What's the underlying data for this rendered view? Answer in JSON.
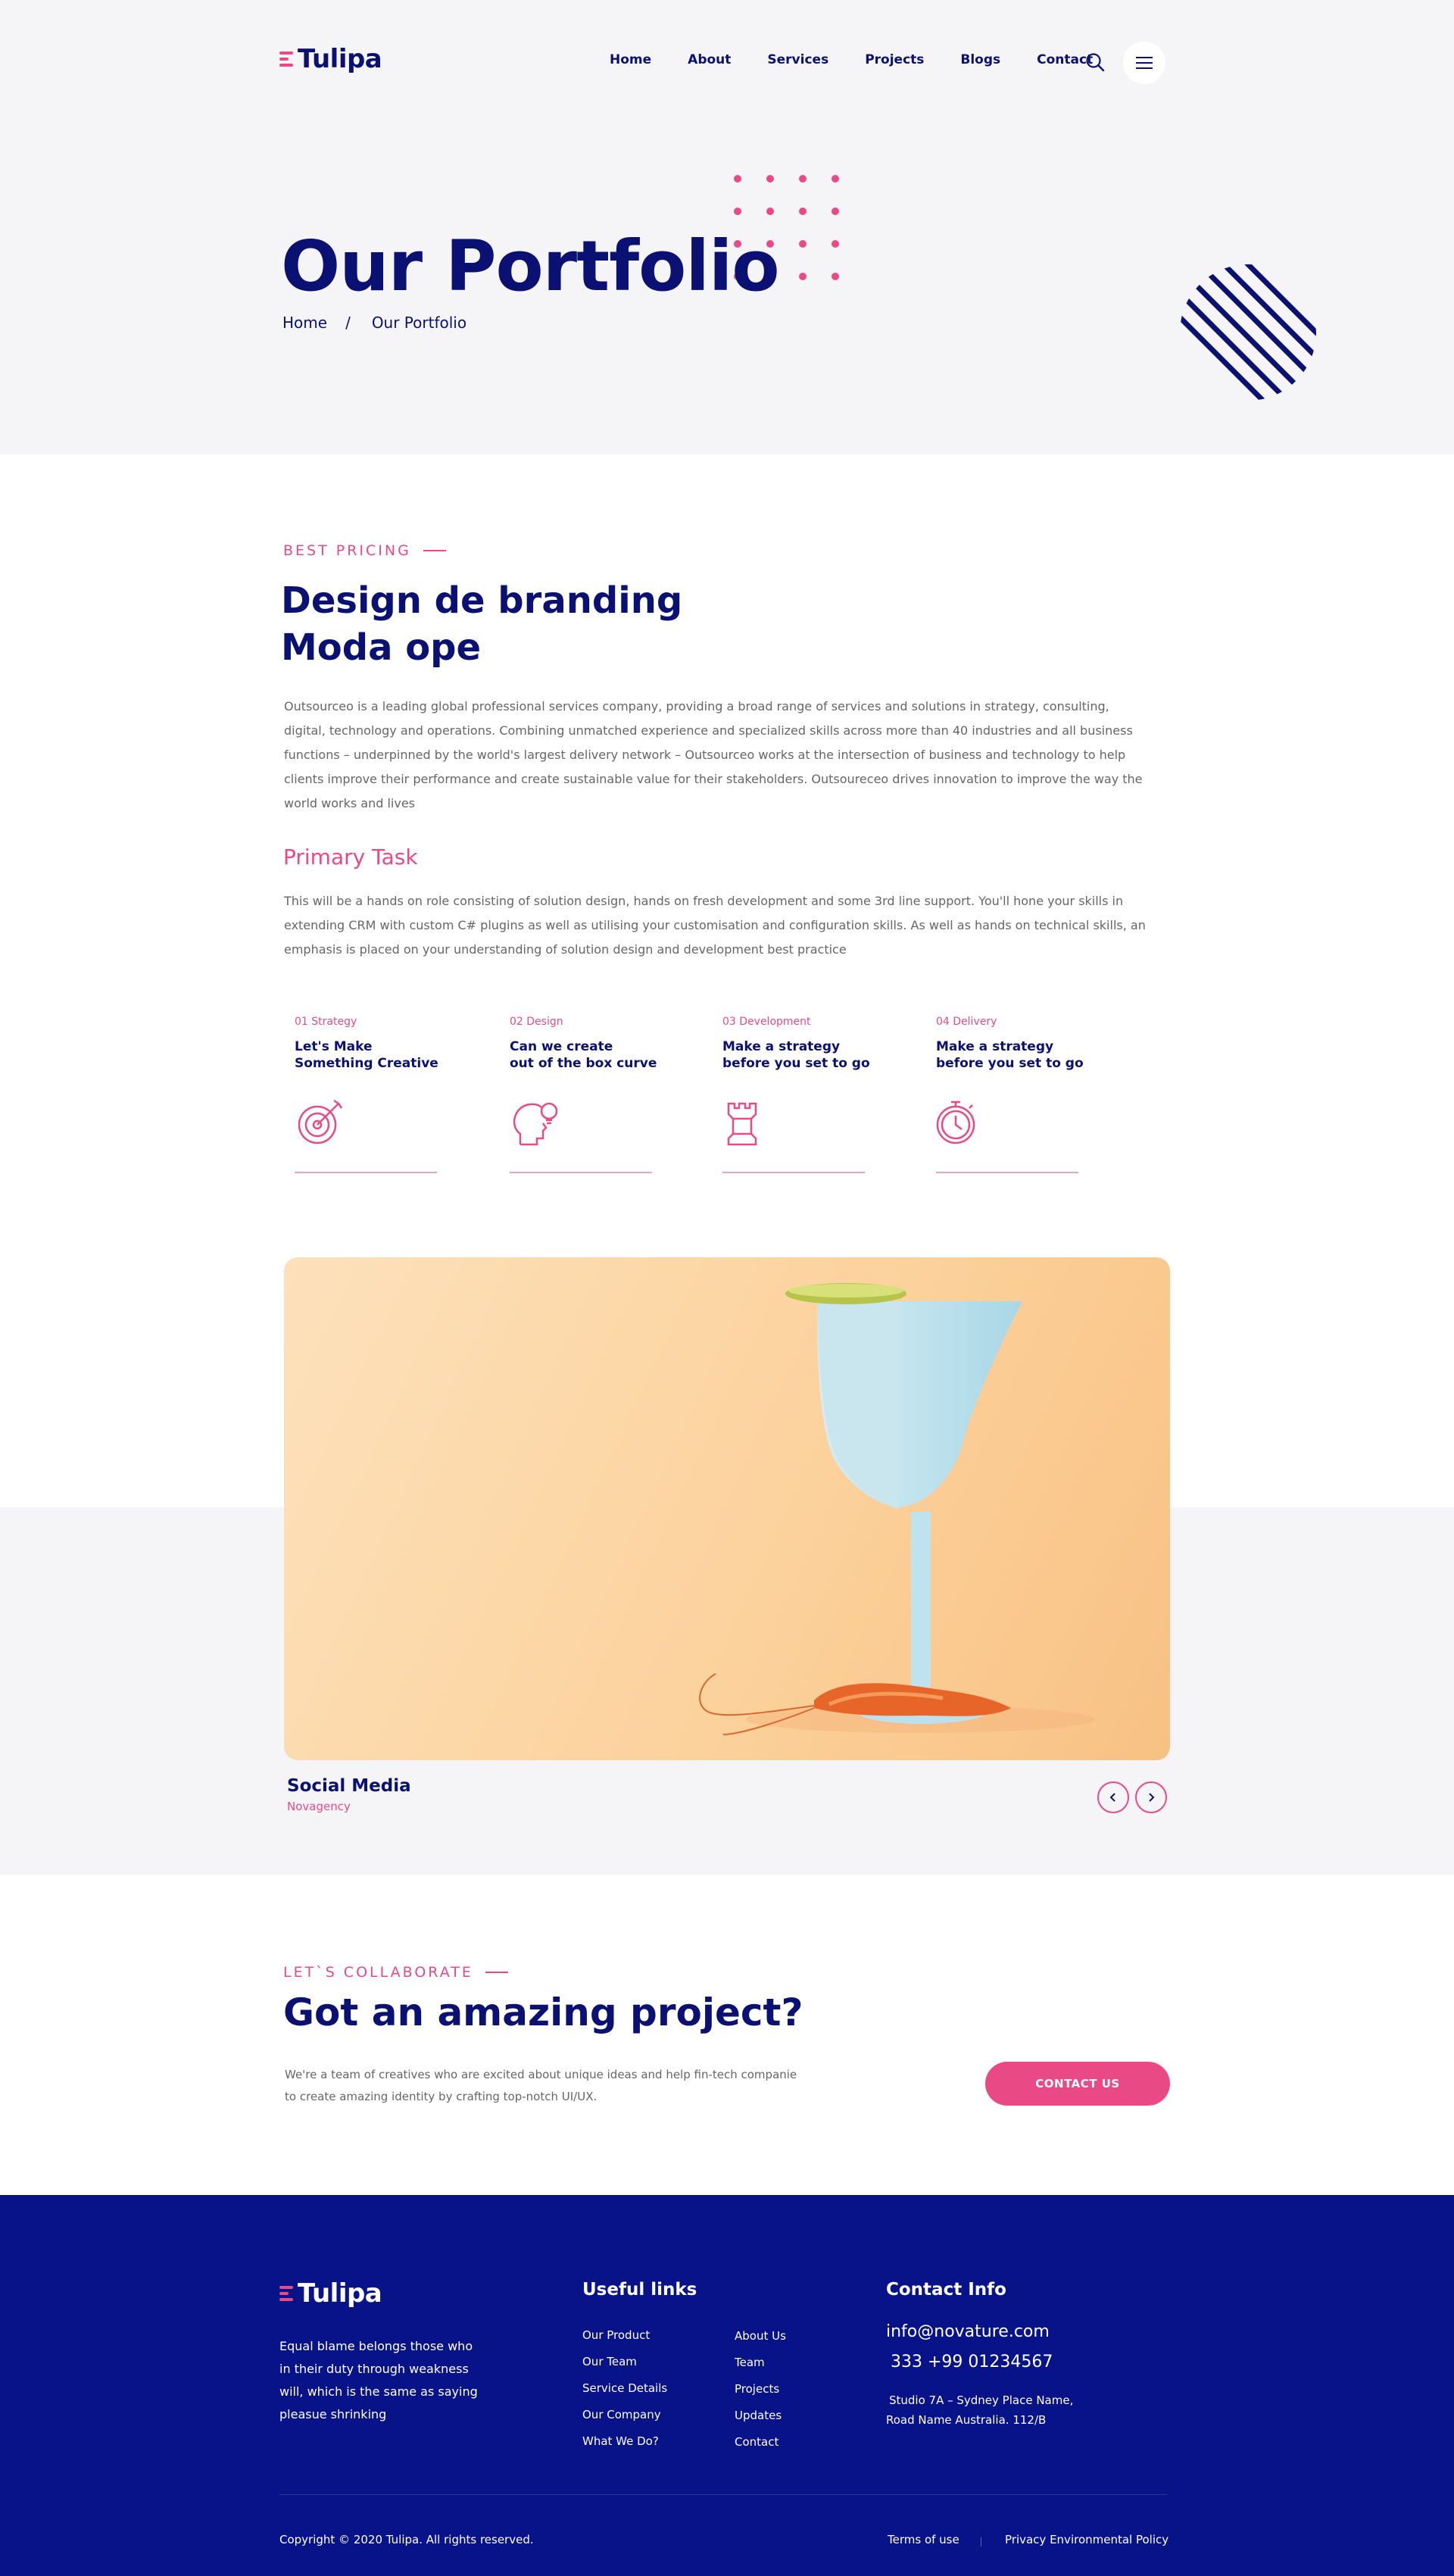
{
  "brand": {
    "name": "Tulipa"
  },
  "nav": {
    "items": [
      "Home",
      "About",
      "Services",
      "Projects",
      "Blogs",
      "Contact"
    ]
  },
  "colors": {
    "primary": "#0a1172",
    "accent": "#e94a86",
    "footer_bg": "#081389",
    "hero_bg": "#f5f5f8"
  },
  "hero": {
    "title": "Our Portfolio",
    "breadcrumb": {
      "home": "Home",
      "separator": "/",
      "current": "Our Portfolio"
    }
  },
  "intro": {
    "eyebrow": "BEST PRICING",
    "title_line1": "Design de branding",
    "title_line2": "Moda ope",
    "paragraph": "Outsourceo is a leading global professional services company, providing a broad range of services and solutions in strategy, consulting, digital, technology and operations. Combining unmatched experience and specialized skills across more than 40 industries and all business functions – underpinned by the world's largest delivery network – Outsourceo works at the intersection of business and technology to help clients improve their performance and create sustainable value for their stakeholders. Outsoureceo drives innovation to improve the way the world works and lives"
  },
  "primary_task": {
    "title": "Primary Task",
    "paragraph": "This will be a hands on role consisting of solution design, hands on fresh development and some 3rd line support. You'll hone your skills in extending CRM with custom C# plugins as well as utilising your customisation and configuration skills. As well as hands on technical skills, an emphasis is placed on your understanding of solution design and development best practice"
  },
  "steps": [
    {
      "num": "01 Strategy",
      "title": "Let's Make\nSomething Creative",
      "icon": "target-icon"
    },
    {
      "num": "02 Design",
      "title": "Can we create\nout of the box curve",
      "icon": "head-idea-icon"
    },
    {
      "num": "03 Development",
      "title": "Make a strategy\nbefore you set to go",
      "icon": "chess-rook-icon"
    },
    {
      "num": "04 Delivery",
      "title": "Make a strategy\nbefore you set to go",
      "icon": "stopwatch-icon"
    }
  ],
  "project": {
    "title": "Social Media",
    "subtitle": "Novagency",
    "prev_icon": "chevron-left-icon",
    "next_icon": "chevron-right-icon"
  },
  "collab": {
    "eyebrow": "LET`S COLLABORATE",
    "title": "Got an amazing project?",
    "paragraph_line1": "We're a team of creatives who are excited about unique ideas and help fin-tech companie",
    "paragraph_line2": "to create amazing identity by crafting top-notch UI/UX.",
    "button": "CONTACT US"
  },
  "footer": {
    "about": [
      "Equal blame belongs those who",
      "in their duty through weakness",
      "will, which is the same as saying",
      "pleasue shrinking"
    ],
    "links_title": "Useful links",
    "links_col1": [
      "Our Product",
      "Our Team",
      "Service Details",
      "Our Company",
      "What We Do?"
    ],
    "links_col2": [
      "About Us",
      "Team",
      "Projects",
      "Updates",
      "Contact"
    ],
    "contact_title": "Contact Info",
    "email": "info@novature.com",
    "phone": "333 +99 01234567",
    "address_line1": "Studio 7A – Sydney Place Name,",
    "address_line2": "Road Name Australia. 112/B",
    "copyright": "Copyright © 2020 Tulipa. All rights reserved.",
    "terms": "Terms of use",
    "privacy": "Privacy Environmental Policy"
  }
}
